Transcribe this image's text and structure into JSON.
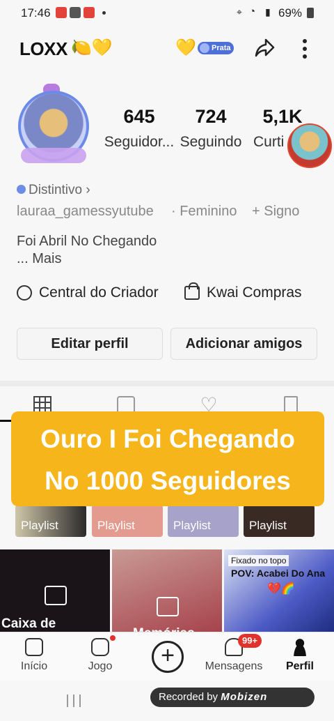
{
  "status_bar": {
    "time": "17:46",
    "battery": "69%"
  },
  "header": {
    "username": "LOXX",
    "username_emojis": "🍋💛",
    "badge_emoji": "💛",
    "badge_label": "Prata"
  },
  "stats": [
    {
      "value": "645",
      "label": "Seguidor..."
    },
    {
      "value": "724",
      "label": "Seguindo"
    },
    {
      "value": "5,1K",
      "label": "Curti"
    }
  ],
  "profile": {
    "distintivo": "Distintivo",
    "handle": "lauraa_gamessyutube",
    "gender": "· Feminino",
    "signo": "+ Signo",
    "bio_line1": "Foi Abril No Chegando",
    "bio_more": "...  Mais"
  },
  "links": {
    "creator_center": "Central do Criador",
    "kwai_shop": "Kwai Compras"
  },
  "buttons": {
    "edit_profile": "Editar perfil",
    "add_friends": "Adicionar amigos"
  },
  "overlay_banner": {
    "line1": "Ouro I Foi Chegando",
    "line2": "No 1000 Seguidores",
    "color": "#f6b51a"
  },
  "playlists": [
    "Playlist",
    "Playlist",
    "Playlist",
    "Playlist"
  ],
  "videos": [
    {
      "title": "Caixa de"
    },
    {
      "title": "Memórias"
    },
    {
      "pinned": "Fixado no topo",
      "caption": "POV: Acabei Do Ana",
      "emojis": "💔🌈"
    }
  ],
  "bottom_nav": {
    "items": [
      "Início",
      "Jogo",
      "Mensagens",
      "Perfil"
    ],
    "messages_badge": "99+"
  },
  "recorder": {
    "label": "Recorded by",
    "brand": "Mobizen"
  }
}
